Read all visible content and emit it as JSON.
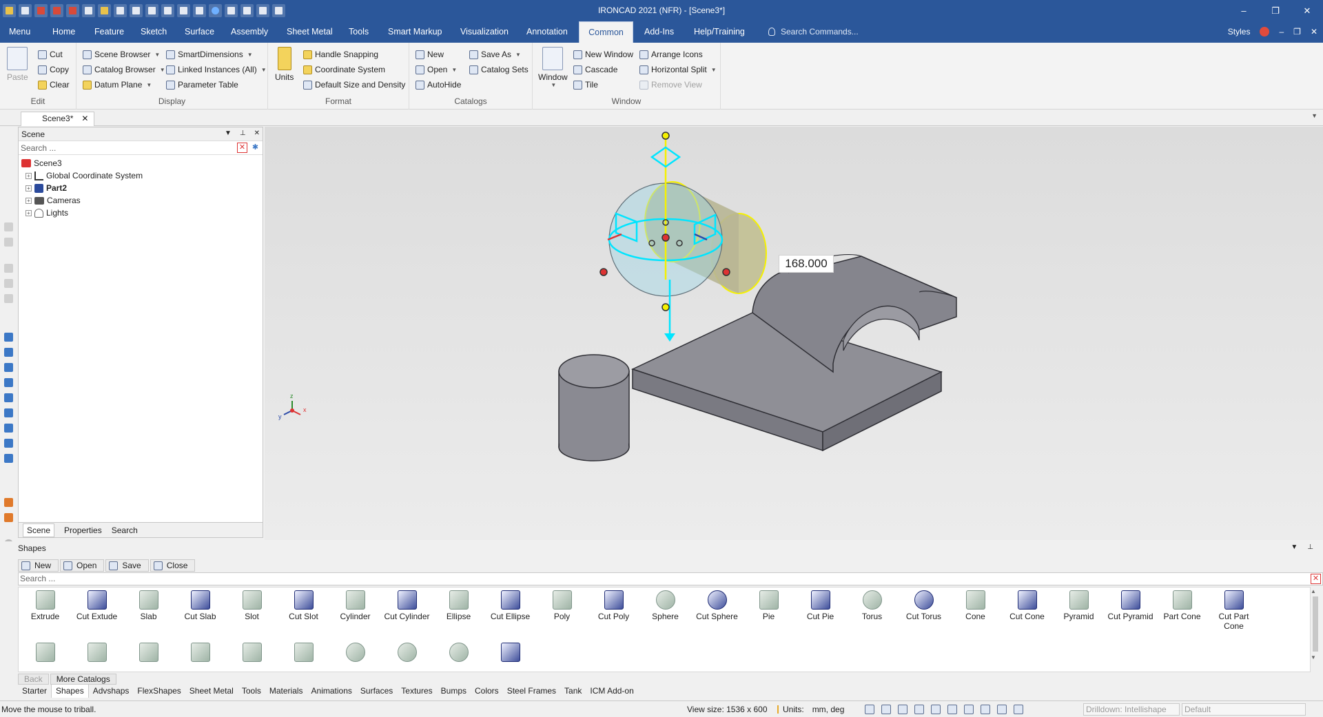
{
  "window": {
    "title": "IRONCAD 2021 (NFR) - [Scene3*]",
    "minimize": "–",
    "restore": "❐",
    "close": "✕"
  },
  "ribbon_tabs": [
    "Menu",
    "Home",
    "Feature",
    "Sketch",
    "Surface",
    "Assembly",
    "Sheet Metal",
    "Tools",
    "Smart Markup",
    "Visualization",
    "Annotation",
    "Common",
    "Add-Ins",
    "Help/Training"
  ],
  "active_tab": "Common",
  "search_commands_placeholder": "Search Commands...",
  "styles_label": "Styles",
  "ribbon": {
    "edit": {
      "label": "Edit",
      "paste": "Paste",
      "cut": "Cut",
      "copy": "Copy",
      "clear": "Clear"
    },
    "display": {
      "label": "Display",
      "scene_browser": "Scene Browser",
      "catalog_browser": "Catalog Browser",
      "datum_plane": "Datum Plane",
      "smart_dimensions": "SmartDimensions",
      "linked_instances": "Linked Instances (All)",
      "parameter_table": "Parameter Table"
    },
    "format": {
      "label": "Format",
      "units": "Units",
      "handle_snapping": "Handle Snapping",
      "coordinate_system": "Coordinate System",
      "default_size_density": "Default Size and Density"
    },
    "catalogs": {
      "label": "Catalogs",
      "new": "New",
      "open": "Open",
      "autohide": "AutoHide",
      "save_as": "Save As",
      "catalog_sets": "Catalog Sets"
    },
    "window": {
      "label": "Window",
      "window": "Window",
      "new_window": "New Window",
      "cascade": "Cascade",
      "tile": "Tile",
      "arrange_icons": "Arrange Icons",
      "horizontal_split": "Horizontal Split",
      "remove_view": "Remove View"
    }
  },
  "doc_tab": {
    "label": "Scene3*",
    "close": "✕"
  },
  "scene_panel": {
    "title": "Scene",
    "search_placeholder": "Search ...",
    "tree": [
      {
        "label": "Scene3",
        "bold": false
      },
      {
        "label": "Global Coordinate System",
        "bold": false
      },
      {
        "label": "Part2",
        "bold": true
      },
      {
        "label": "Cameras",
        "bold": false
      },
      {
        "label": "Lights",
        "bold": false
      }
    ],
    "tabs": [
      "Scene",
      "Properties",
      "Search"
    ]
  },
  "viewport": {
    "dimension_value": "168.000",
    "triad_labels": {
      "x": "x",
      "y": "y",
      "z": "z"
    },
    "colors": {
      "handle": "#00e5ff",
      "highlight": "#f5f100",
      "part": "#8f8f96"
    }
  },
  "shapes_panel": {
    "title": "Shapes",
    "buttons": [
      "New",
      "Open",
      "Save",
      "Close"
    ],
    "search_placeholder": "Search ...",
    "items": [
      "Extrude",
      "Cut Extude",
      "Slab",
      "Cut Slab",
      "Slot",
      "Cut Slot",
      "Cylinder",
      "Cut Cylinder",
      "Ellipse",
      "Cut Ellipse",
      "Poly",
      "Cut Poly",
      "Sphere",
      "Cut Sphere",
      "Pie",
      "Cut Pie",
      "Torus",
      "Cut Torus",
      "Cone",
      "Cut Cone",
      "Pyramid",
      "Cut Pyramid",
      "Part Cone",
      "Cut Part Cone"
    ],
    "back": "Back",
    "more_catalogs": "More Catalogs",
    "catalog_tabs": [
      "Starter",
      "Shapes",
      "Advshaps",
      "FlexShapes",
      "Sheet Metal",
      "Tools",
      "Materials",
      "Animations",
      "Surfaces",
      "Textures",
      "Bumps",
      "Colors",
      "Steel Frames",
      "Tank",
      "ICM Add-on"
    ],
    "active_catalog": "Shapes"
  },
  "status": {
    "message": "Move the mouse to triball.",
    "view_size": "View size: 1536 x  600",
    "units_label": "Units:",
    "units_value": "mm, deg",
    "drilldown": "Drilldown: Intellishape",
    "default_combo": "Default"
  }
}
